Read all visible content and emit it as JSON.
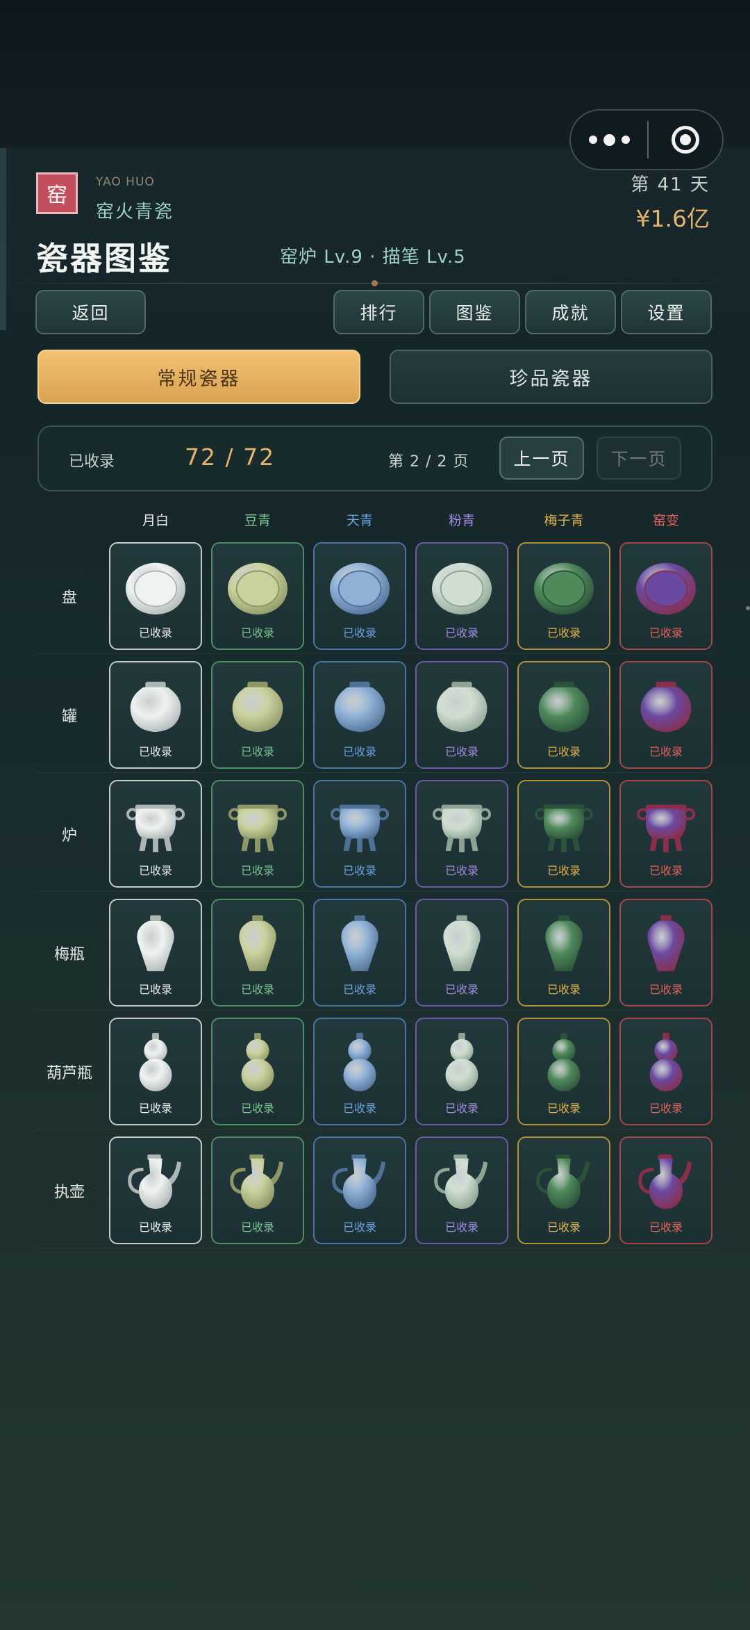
{
  "topbar": {
    "menu_icon": "more-dots-icon",
    "close_icon": "target-icon"
  },
  "header": {
    "logo_char": "窑",
    "game_name_en": "YAO HUO",
    "game_name_cn": "窑火青瓷",
    "day": "第 41 天",
    "money": "¥1.6亿",
    "title": "瓷器图鉴",
    "levels": "窑炉 Lv.9 · 描笔 Lv.5"
  },
  "nav": {
    "back": "返回",
    "rank": "排行",
    "collection": "图鉴",
    "achievements": "成就",
    "settings": "设置"
  },
  "tabs": {
    "regular": "常规瓷器",
    "rare": "珍品瓷器"
  },
  "stats": {
    "label": "已收录",
    "count": "72 / 72",
    "page": "第 2 / 2 页",
    "prev": "上一页",
    "next": "下一页"
  },
  "glazes": [
    {
      "name": "月白",
      "color": "#e6ebe8",
      "body": "#eef2f1",
      "dark": "#aeb6b4",
      "border": "#c6ccca",
      "label_color": "#eceeec"
    },
    {
      "name": "豆青",
      "color": "#7ac48f",
      "body": "#c9d19c",
      "dark": "#8e9866",
      "border": "#4c8f62",
      "label_color": "#7ac48f"
    },
    {
      "name": "天青",
      "color": "#6aa3df",
      "body": "#8fb1d6",
      "dark": "#4f7197",
      "border": "#4b73a6",
      "label_color": "#6aa3df"
    },
    {
      "name": "粉青",
      "color": "#a48be0",
      "body": "#cfded1",
      "dark": "#8ea394",
      "border": "#6d59a8",
      "label_color": "#a48be0"
    },
    {
      "name": "梅子青",
      "color": "#e0b24d",
      "body": "#4f8a5b",
      "dark": "#2b523a",
      "border": "#b29238",
      "label_color": "#e0b24d"
    },
    {
      "name": "窑变",
      "color": "#e4615c",
      "body": "#6a4aa0",
      "dark": "#8a2e4a",
      "border": "#a84545",
      "label_color": "#e4615c"
    }
  ],
  "vessels": [
    "盘",
    "罐",
    "炉",
    "梅瓶",
    "葫芦瓶",
    "执壶"
  ],
  "cell_status": "已收录"
}
